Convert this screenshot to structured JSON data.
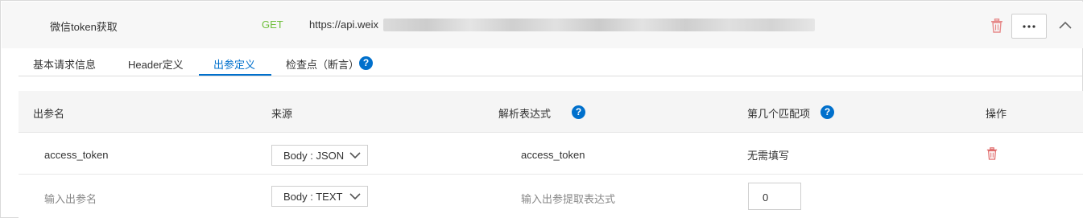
{
  "api": {
    "name": "微信token获取",
    "method": "GET",
    "url": "https://api.weix",
    "method_color": "#6fbf3c"
  },
  "tabs": [
    {
      "label": "基本请求信息"
    },
    {
      "label": "Header定义"
    },
    {
      "label": "出参定义"
    },
    {
      "label": "检查点（断言）"
    }
  ],
  "active_tab": "出参定义",
  "help_glyph": "?",
  "table": {
    "headers": {
      "name": "出参名",
      "source": "来源",
      "expression": "解析表达式",
      "match_index": "第几个匹配项",
      "actions": "操作"
    },
    "rows": [
      {
        "name": "access_token",
        "source": "Body : JSON",
        "expression": "access_token",
        "match_index": "无需填写"
      }
    ],
    "new_row": {
      "name_placeholder": "输入出参名",
      "source": "Body : TEXT",
      "expression_placeholder": "输入出参提取表达式",
      "match_index": "0"
    }
  },
  "colors": {
    "accent": "#0070cc",
    "delete": "#e06b6b"
  }
}
